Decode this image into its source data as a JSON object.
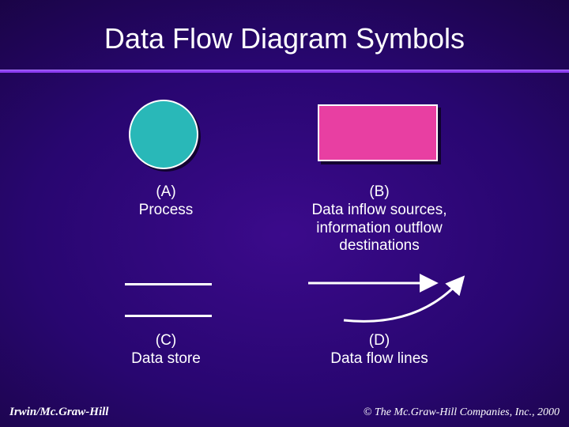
{
  "title": "Data Flow Diagram Symbols",
  "symbols": {
    "a": {
      "tag": "(A)",
      "label": "Process",
      "shape": "circle",
      "color": "#29b8b8"
    },
    "b": {
      "tag": "(B)",
      "label": "Data inflow sources,\ninformation outflow\ndestinations",
      "shape": "rect",
      "color": "#e83fa2"
    },
    "c": {
      "tag": "(C)",
      "label": "Data store",
      "shape": "parallel-lines"
    },
    "d": {
      "tag": "(D)",
      "label": "Data flow  lines",
      "shape": "flow-arrows"
    }
  },
  "footer": {
    "left": "Irwin/Mc.Graw-Hill",
    "right": "© The Mc.Graw-Hill Companies, Inc., 2000"
  }
}
